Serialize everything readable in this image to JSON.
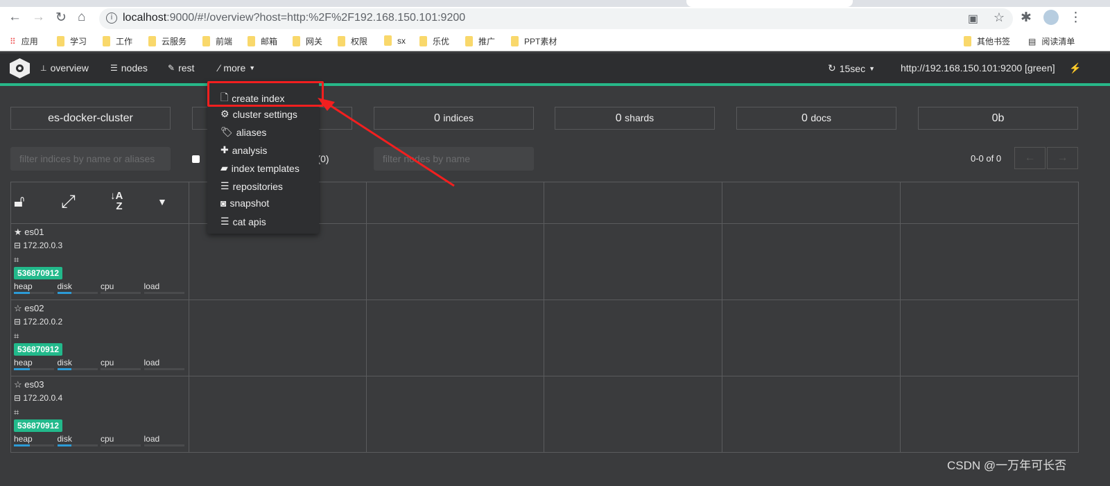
{
  "browser": {
    "url_host": "localhost",
    "url_rest": ":9000/#!/overview?host=http:%2F%2F192.168.150.101:9200",
    "bookmarks": [
      "应用",
      "学习",
      "工作",
      "云服务",
      "前端",
      "邮箱",
      "网关",
      "权限",
      "sx",
      "乐优",
      "推广",
      "PPT素材"
    ],
    "other_bookmarks": "其他书签",
    "reading_list": "阅读清单"
  },
  "navbar": {
    "overview": "overview",
    "nodes": "nodes",
    "rest": "rest",
    "more": "more",
    "refresh": "15sec",
    "host": "http://192.168.150.101:9200 [green]"
  },
  "stats": {
    "cluster": "es-docker-cluster",
    "indices_n": "0",
    "indices_l": "indices",
    "shards_n": "0",
    "shards_l": "shards",
    "docs_n": "0",
    "docs_l": "docs",
    "size": "0b"
  },
  "filters": {
    "indices_placeholder": "filter indices by name or aliases",
    "special": "special (0)",
    "nodes_placeholder": "filter nodes by name",
    "pagination": "0-0 of 0",
    "prev": "←",
    "next": "→"
  },
  "nodes": [
    {
      "name": "es01",
      "ip": "172.20.0.3",
      "master": true,
      "badge": "536870912",
      "heap": 0.4,
      "disk": 0.35,
      "cpu": 0,
      "load": 0
    },
    {
      "name": "es02",
      "ip": "172.20.0.2",
      "master": false,
      "badge": "536870912",
      "heap": 0.4,
      "disk": 0.35,
      "cpu": 0,
      "load": 0
    },
    {
      "name": "es03",
      "ip": "172.20.0.4",
      "master": false,
      "badge": "536870912",
      "heap": 0.4,
      "disk": 0.35,
      "cpu": 0,
      "load": 0
    }
  ],
  "metric_labels": [
    "heap",
    "disk",
    "cpu",
    "load"
  ],
  "menu": {
    "items": [
      "create index",
      "cluster settings",
      "aliases",
      "analysis",
      "index templates",
      "repositories",
      "snapshot",
      "cat apis"
    ]
  },
  "watermark": "CSDN @一万年可长否",
  "colors": {
    "accent": "#27b889",
    "annotation": "#f21f1f"
  }
}
